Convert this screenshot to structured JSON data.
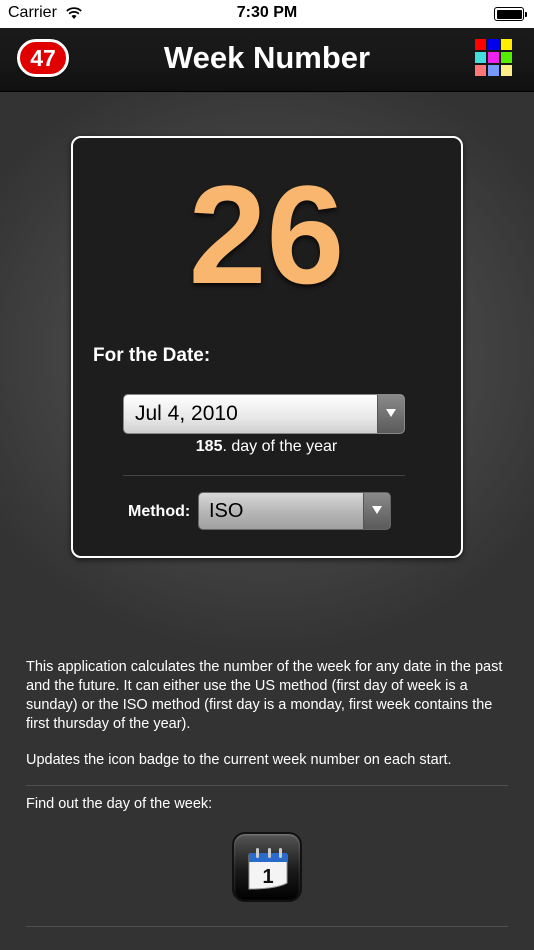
{
  "status_bar": {
    "carrier": "Carrier",
    "time": "7:30 PM"
  },
  "nav": {
    "title": "Week Number",
    "badge_value": "47",
    "badge_color": "#e00000"
  },
  "grid_icon_colors": [
    "#ff0000",
    "#0000ee",
    "#ffee00",
    "#44dddd",
    "#ee22ee",
    "#55ee00",
    "#ff7777",
    "#7799ff",
    "#ffee88"
  ],
  "card": {
    "week_number": "26",
    "week_number_color": "#f9b66e",
    "for_date_label": "For the Date:",
    "date_value": "Jul 4, 2010",
    "day_of_year_num": "185",
    "day_of_year_suffix": ". day of the year",
    "method_label": "Method:",
    "method_value": "ISO"
  },
  "info": {
    "description": "This application calculates the number of the week for any date in the past and the future. It can either use the US method (first day of week is a sunday) or the ISO method (first day is a monday, first week contains the first thursday of the year).",
    "badge_note": "Updates the icon badge to the current week number on each start.",
    "find_out": "Find out the day of the week:",
    "app_icon": "calendar-icon",
    "app_icon_day": "1"
  }
}
